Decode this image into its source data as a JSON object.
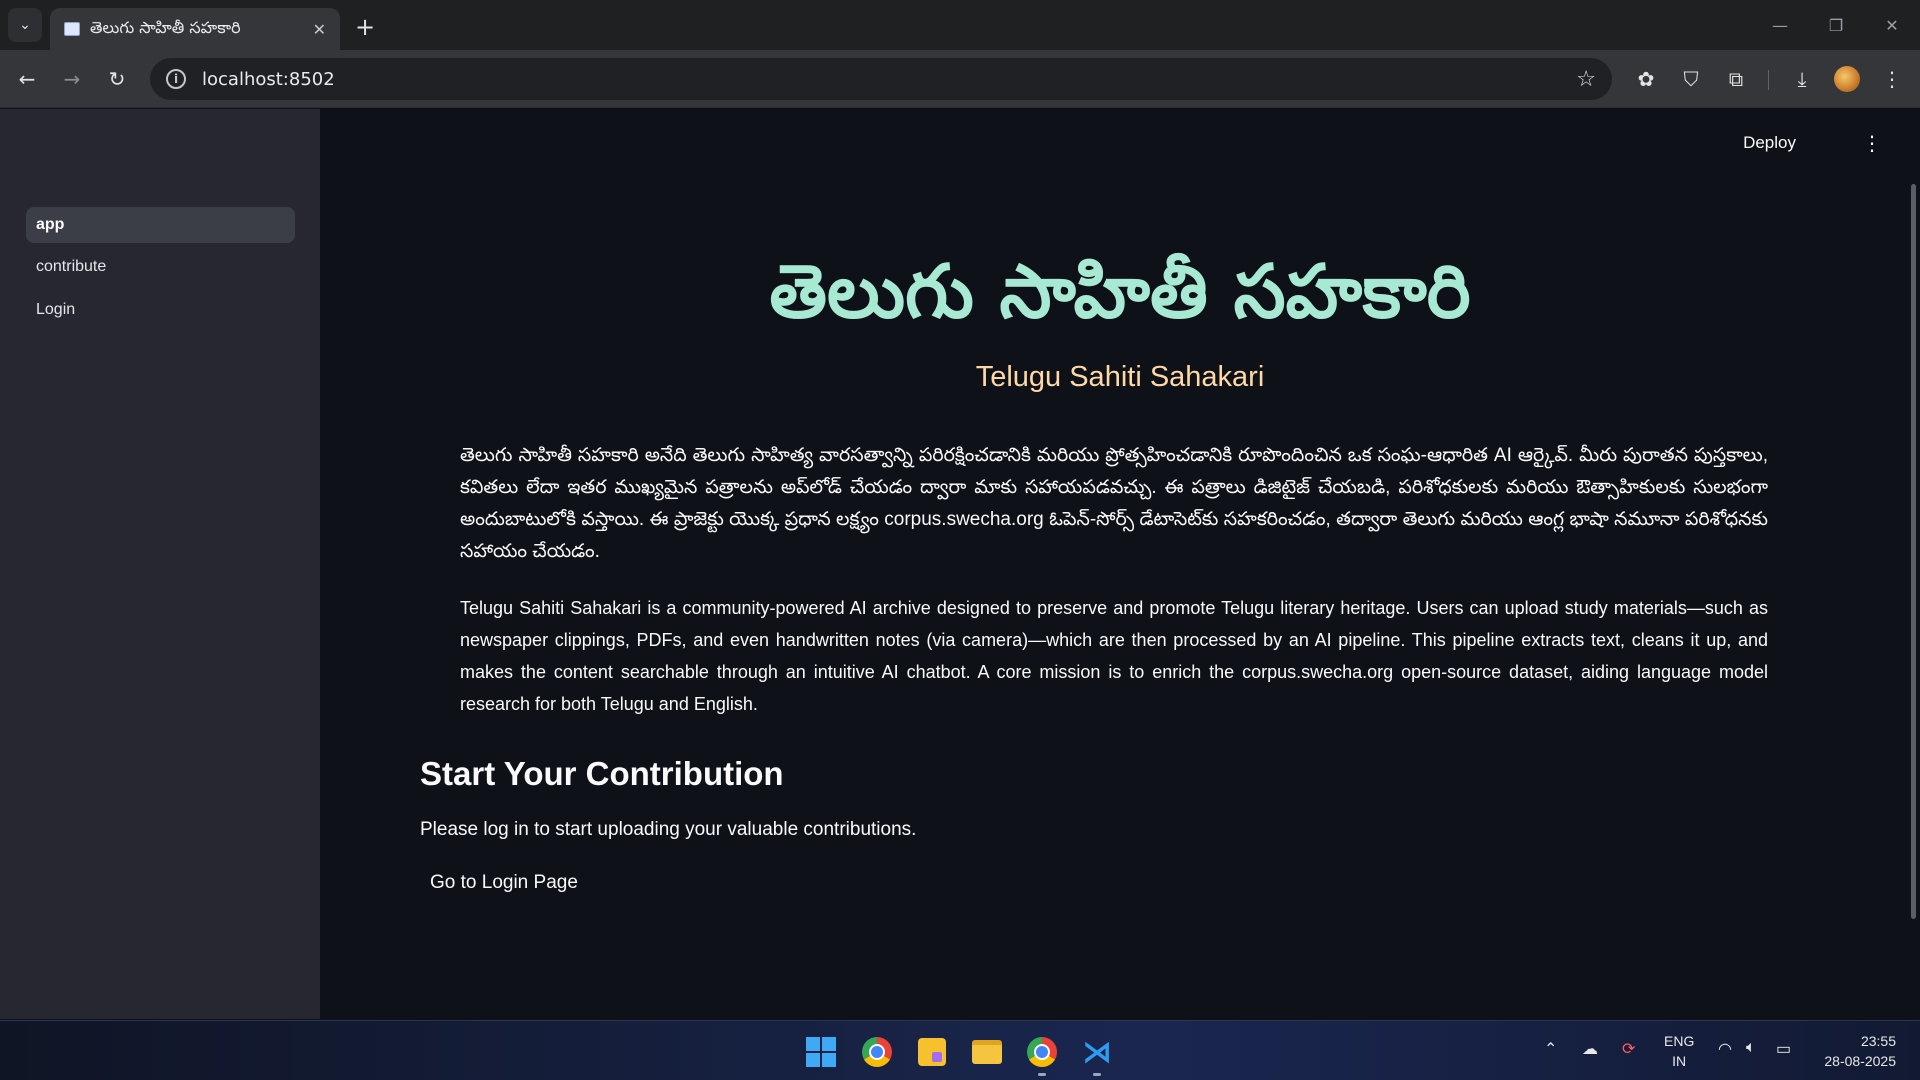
{
  "browser": {
    "tab_title": "తెలుగు సాహితీ సహకారి",
    "url": "localhost:8502"
  },
  "sidebar": {
    "items": [
      {
        "label": "app",
        "active": true
      },
      {
        "label": "contribute",
        "active": false
      },
      {
        "label": "Login",
        "active": false
      }
    ]
  },
  "header": {
    "deploy_label": "Deploy"
  },
  "main": {
    "title_telugu": "తెలుగు సాహితీ సహకారి",
    "subtitle": "Telugu Sahiti Sahakari",
    "paragraph_telugu": "తెలుగు సాహితీ సహకారి అనేది తెలుగు సాహిత్య వారసత్వాన్ని పరిరక్షించడానికి మరియు ప్రోత్సహించడానికి రూపొందించిన ఒక సంఘ-ఆధారిత AI ఆర్కైవ్. మీరు పురాతన పుస్తకాలు, కవితలు లేదా ఇతర ముఖ్యమైన పత్రాలను అప్‌లోడ్ చేయడం ద్వారా మాకు సహాయపడవచ్చు. ఈ పత్రాలు డిజిటైజ్ చేయబడి, పరిశోధకులకు మరియు ఔత్సాహికులకు సులభంగా అందుబాటులోకి వస్తాయి. ఈ ప్రాజెక్టు యొక్క ప్రధాన లక్ష్యం corpus.swecha.org ఓపెన్-సోర్స్ డేటాసెట్‌కు సహకరించడం, తద్వారా తెలుగు మరియు ఆంగ్ల భాషా నమూనా పరిశోధనకు సహాయం చేయడం.",
    "paragraph_english": "Telugu Sahiti Sahakari is a community-powered AI archive designed to preserve and promote Telugu literary heritage. Users can upload study materials—such as newspaper clippings, PDFs, and even handwritten notes (via camera)—which are then processed by an AI pipeline. This pipeline extracts text, cleans it up, and makes the content searchable through an intuitive AI chatbot. A core mission is to enrich the corpus.swecha.org open-source dataset, aiding language model research for both Telugu and English.",
    "section_heading": "Start Your Contribution",
    "login_message": "Please log in to start uploading your valuable contributions.",
    "login_button": "Go to Login Page"
  },
  "taskbar": {
    "language": "ENG",
    "region": "IN",
    "time": "23:55",
    "date": "28-08-2025"
  },
  "colors": {
    "title": "#a7e9d3",
    "subtitle": "#ffd8a8",
    "background": "#0e1117",
    "sidebar": "#262730"
  }
}
